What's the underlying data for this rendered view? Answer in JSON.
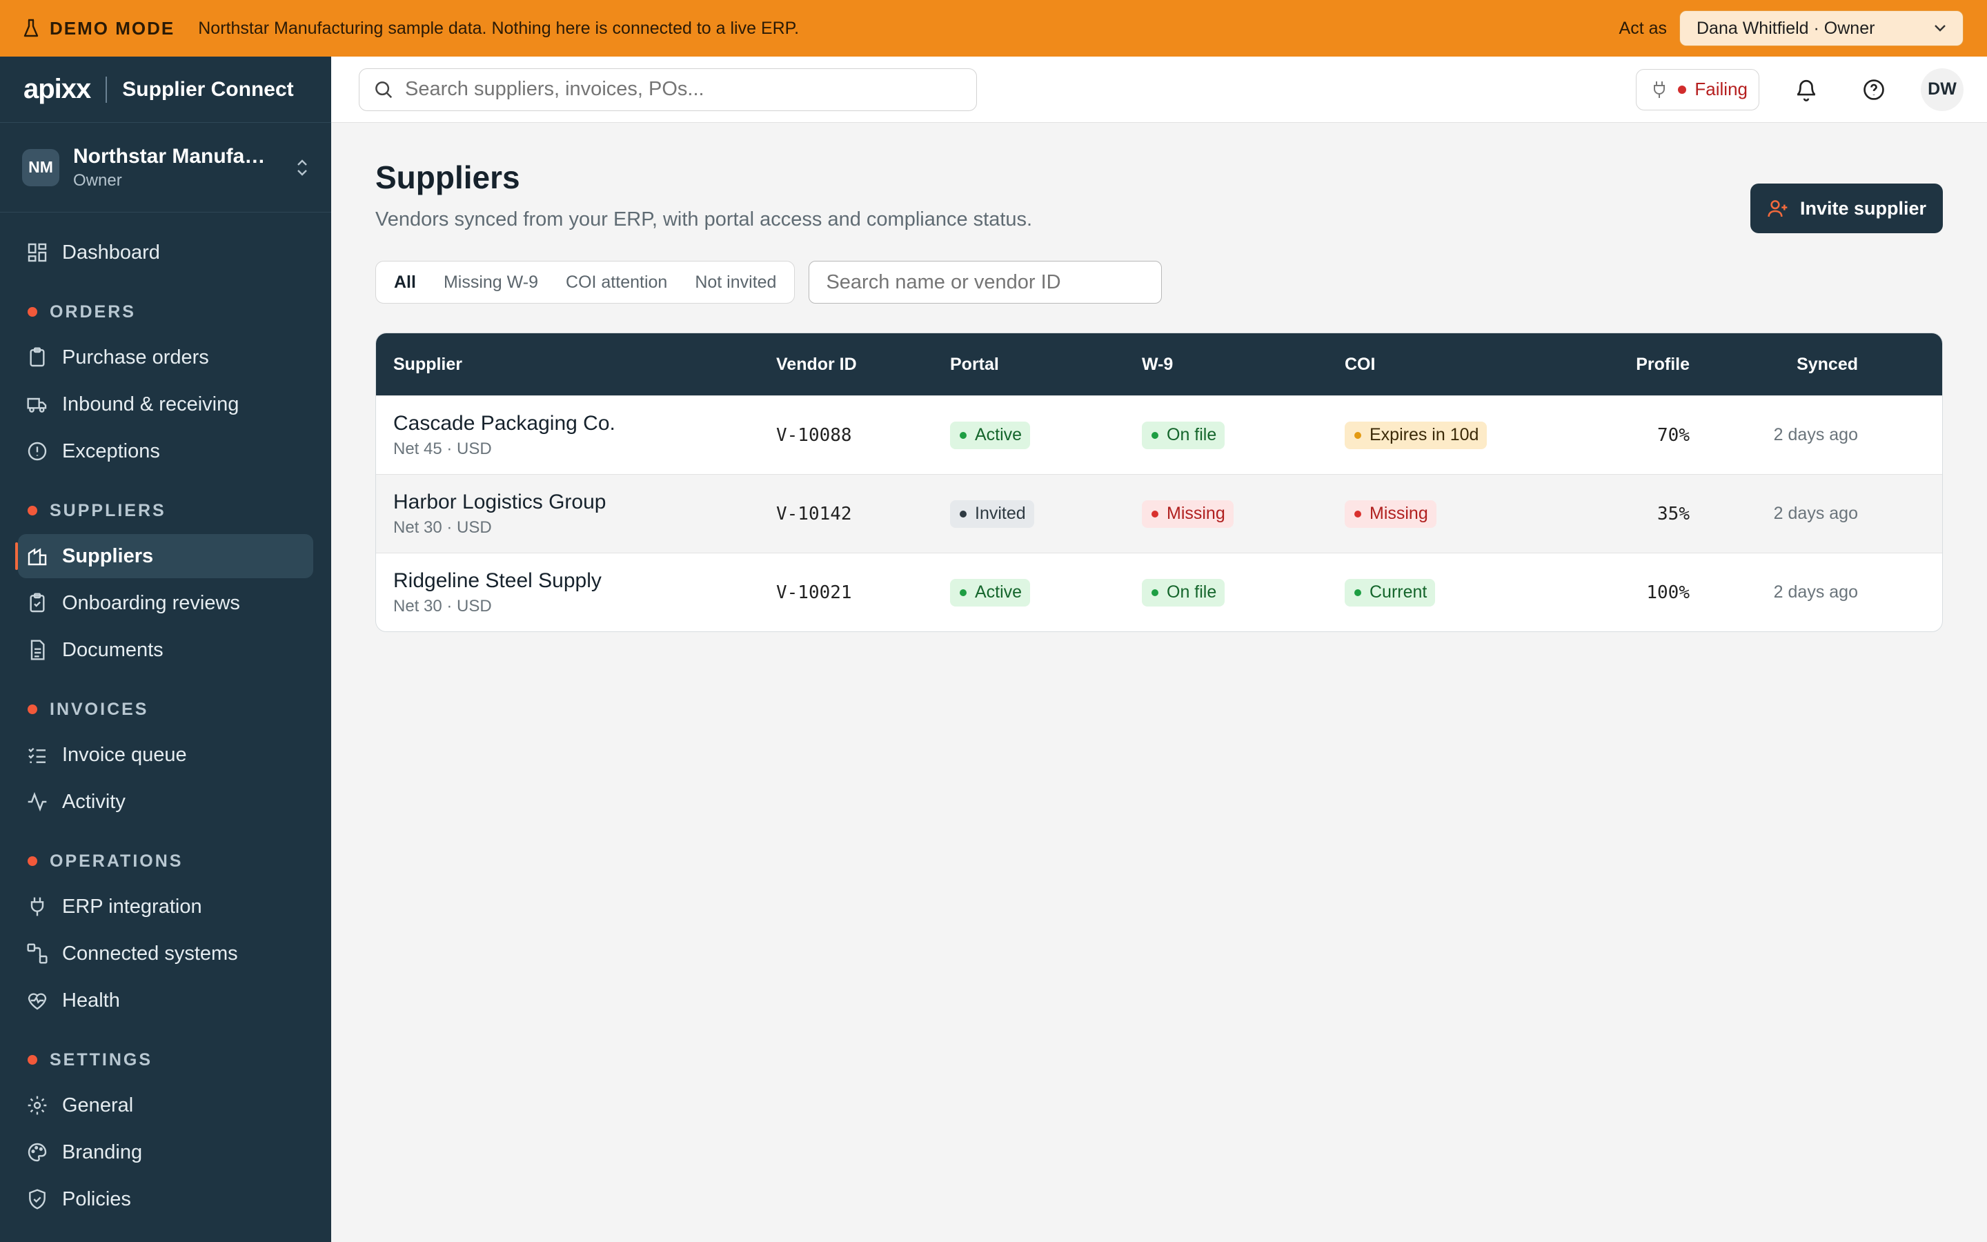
{
  "demo": {
    "tag": "DEMO MODE",
    "message": "Northstar Manufacturing sample data. Nothing here is connected to a live ERP.",
    "act_as_label": "Act as",
    "act_as_value": "Dana Whitfield · Owner"
  },
  "brand": {
    "logo": "apixx",
    "product": "Supplier Connect"
  },
  "org": {
    "initials": "NM",
    "name": "Northstar Manufacturing",
    "role": "Owner"
  },
  "nav": {
    "dashboard": "Dashboard",
    "orders_section": "ORDERS",
    "purchase_orders": "Purchase orders",
    "inbound": "Inbound & receiving",
    "exceptions": "Exceptions",
    "suppliers_section": "SUPPLIERS",
    "suppliers": "Suppliers",
    "onboarding": "Onboarding reviews",
    "documents": "Documents",
    "invoices_section": "INVOICES",
    "invoice_queue": "Invoice queue",
    "activity": "Activity",
    "operations_section": "OPERATIONS",
    "erp": "ERP integration",
    "connected": "Connected systems",
    "health": "Health",
    "settings_section": "SETTINGS",
    "general": "General",
    "branding": "Branding",
    "policies": "Policies"
  },
  "topbar": {
    "search_placeholder": "Search suppliers, invoices, POs...",
    "health_status": "Failing",
    "user_initials": "DW"
  },
  "page": {
    "title": "Suppliers",
    "subtitle": "Vendors synced from your ERP, with portal access and compliance status.",
    "invite_label": "Invite supplier",
    "filters": [
      "All",
      "Missing W-9",
      "COI attention",
      "Not invited"
    ],
    "filter_search_placeholder": "Search name or vendor ID"
  },
  "table": {
    "columns": [
      "Supplier",
      "Vendor ID",
      "Portal",
      "W-9",
      "COI",
      "Profile",
      "Synced"
    ],
    "rows": [
      {
        "name": "Cascade Packaging Co.",
        "terms": "Net 45 · USD",
        "vendor_id": "V-10088",
        "portal": "Active",
        "w9": "On file",
        "coi": "Expires in 10d",
        "profile": "70%",
        "synced": "2 days ago"
      },
      {
        "name": "Harbor Logistics Group",
        "terms": "Net 30 · USD",
        "vendor_id": "V-10142",
        "portal": "Invited",
        "w9": "Missing",
        "coi": "Missing",
        "profile": "35%",
        "synced": "2 days ago"
      },
      {
        "name": "Ridgeline Steel Supply",
        "terms": "Net 30 · USD",
        "vendor_id": "V-10021",
        "portal": "Active",
        "w9": "On file",
        "coi": "Current",
        "profile": "100%",
        "synced": "2 days ago"
      }
    ]
  },
  "colors": {
    "banner": "#f08a1a",
    "sidebar": "#1e3442",
    "accent_dot": "#f2593a",
    "primary_button": "#1f3442"
  }
}
